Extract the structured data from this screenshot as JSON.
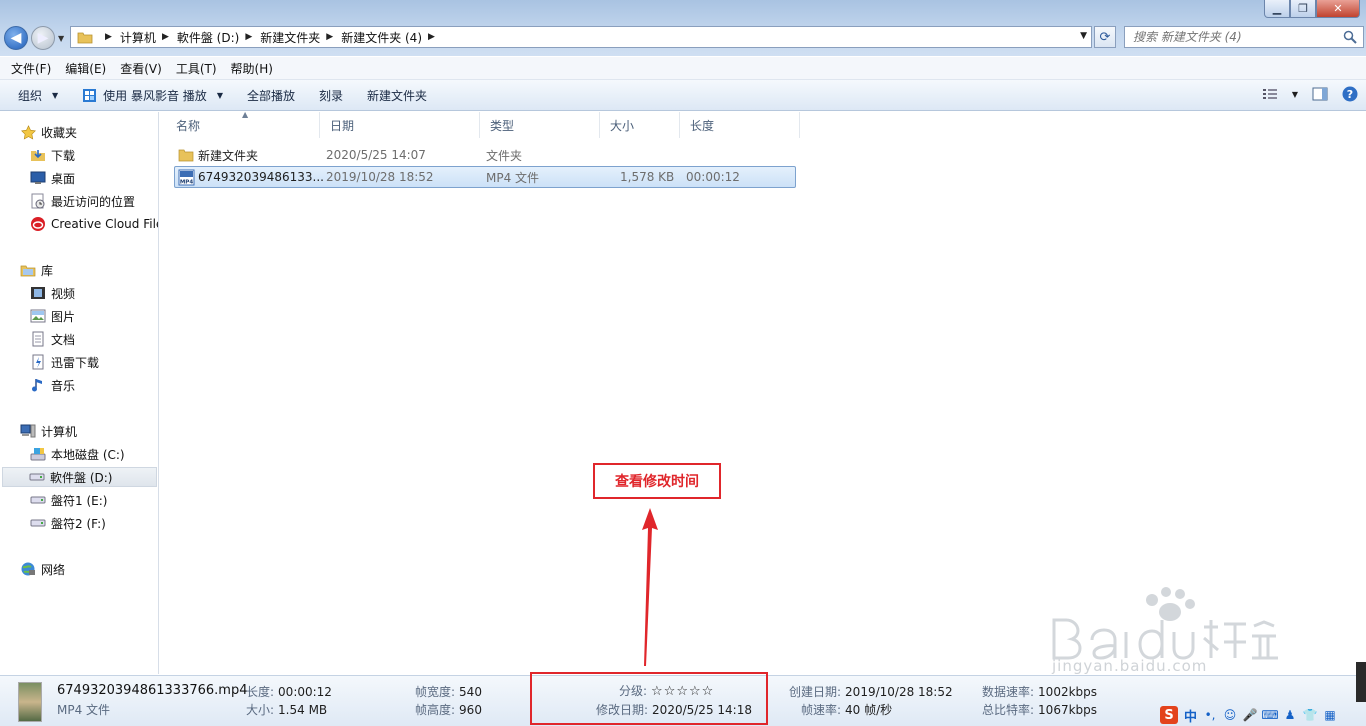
{
  "address": {
    "crumbs": [
      "计算机",
      "軟件盤 (D:)",
      "新建文件夹",
      "新建文件夹 (4)"
    ],
    "search_placeholder": "搜索 新建文件夹 (4)"
  },
  "window": {
    "min_label": "▁",
    "max_label": "❐",
    "close_label": "✕"
  },
  "menu": [
    "文件(F)",
    "编辑(E)",
    "查看(V)",
    "工具(T)",
    "帮助(H)"
  ],
  "commands": {
    "organize": "组织",
    "play_with": "使用 暴风影音 播放",
    "play_all": "全部播放",
    "burn": "刻录",
    "new_folder": "新建文件夹"
  },
  "nav": {
    "favorites": {
      "label": "收藏夹",
      "items": [
        "下载",
        "桌面",
        "最近访问的位置",
        "Creative Cloud Files"
      ]
    },
    "libraries": {
      "label": "库",
      "items": [
        "视频",
        "图片",
        "文档",
        "迅雷下载",
        "音乐"
      ]
    },
    "computer": {
      "label": "计算机",
      "items": [
        "本地磁盘 (C:)",
        "軟件盤 (D:)",
        "盤符1 (E:)",
        "盤符2 (F:)"
      ]
    },
    "network": {
      "label": "网络"
    }
  },
  "columns": [
    "名称",
    "日期",
    "类型",
    "大小",
    "长度"
  ],
  "files": [
    {
      "name": "新建文件夹",
      "date": "2020/5/25 14:07",
      "type": "文件夹",
      "size": "",
      "length": ""
    },
    {
      "name": "674932039486133...",
      "date": "2019/10/28 18:52",
      "type": "MP4 文件",
      "size": "1,578 KB",
      "length": "00:00:12"
    }
  ],
  "annotation": {
    "text": "查看修改时间"
  },
  "details": {
    "filename": "6749320394861333766.mp4",
    "filetype": "MP4 文件",
    "length_label": "长度:",
    "length": "00:00:12",
    "size_label": "大小:",
    "size": "1.54 MB",
    "frame_width_label": "帧宽度:",
    "frame_width": "540",
    "frame_height_label": "帧高度:",
    "frame_height": "960",
    "rating_label": "分级:",
    "rating_stars": "☆☆☆☆☆",
    "modified_label": "修改日期:",
    "modified": "2020/5/25 14:18",
    "created_label": "创建日期:",
    "created": "2019/10/28 18:52",
    "fps_label": "帧速率:",
    "fps": "40 帧/秒",
    "data_rate_label": "数据速率:",
    "data_rate": "1002kbps",
    "total_bitrate_label": "总比特率:",
    "total_bitrate": "1067kbps"
  },
  "watermark": {
    "url": "jingyan.baidu.com"
  },
  "tray": {
    "ime": "中"
  }
}
